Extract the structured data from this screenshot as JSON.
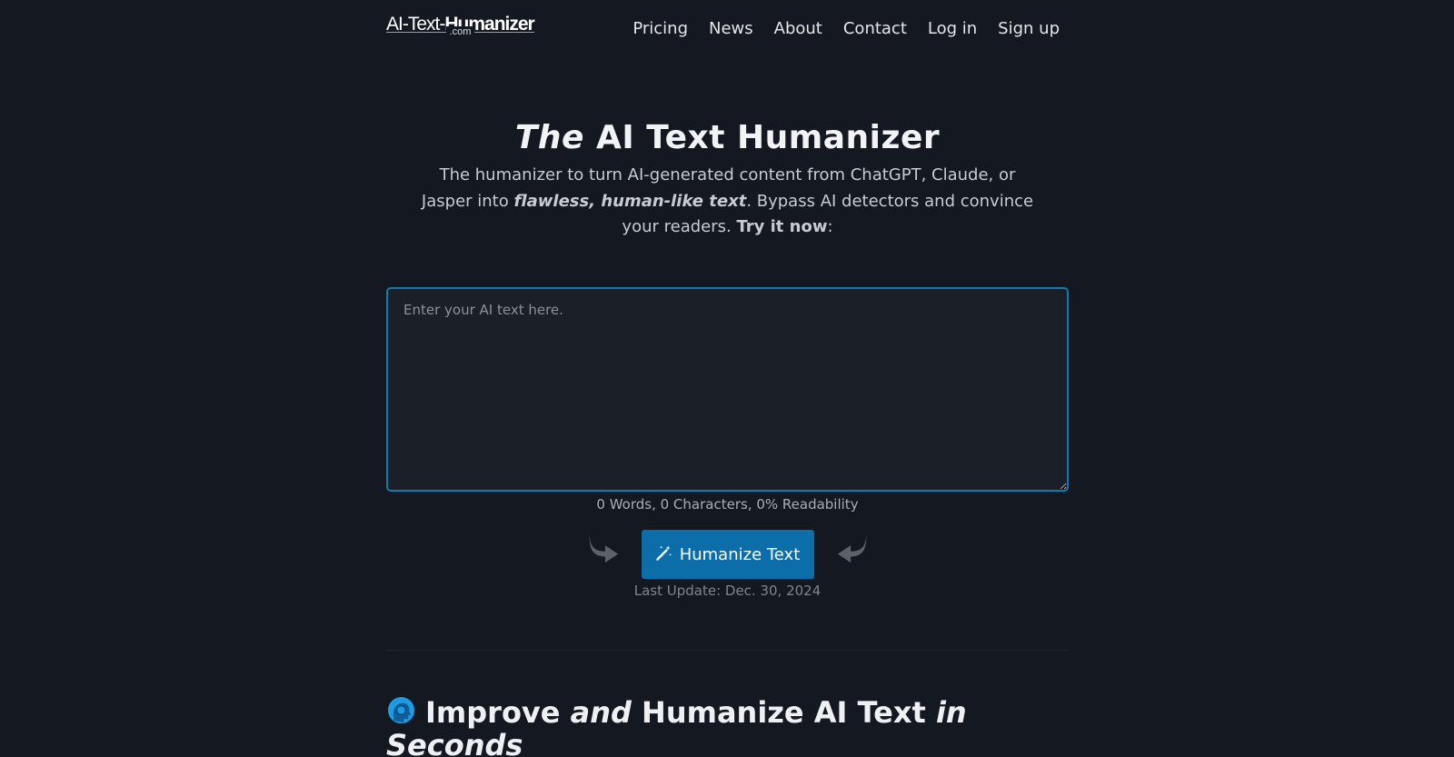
{
  "header": {
    "logo_part1": "AI-Text-",
    "logo_part2": "Humanizer",
    "logo_sub": ".com",
    "nav": [
      "Pricing",
      "News",
      "About",
      "Contact",
      "Log in",
      "Sign up"
    ]
  },
  "hero": {
    "title_em": "The",
    "title_rest": " AI Text Humanizer",
    "desc_1": "The humanizer to turn AI-generated content from ChatGPT, Claude, or Jasper into ",
    "desc_em": "flawless, human-like text",
    "desc_2": ". Bypass AI detectors and convince your readers. ",
    "desc_strong": "Try it now",
    "desc_3": ":"
  },
  "editor": {
    "placeholder": "Enter your AI text here.",
    "value": "",
    "stats": "0 Words, 0 Characters, 0% Readability"
  },
  "actions": {
    "button_label": "Humanize Text",
    "button_icon": "magic-wand-icon",
    "left_arrow_icon": "curved-arrow-right-icon",
    "right_arrow_icon": "curved-arrow-left-icon",
    "last_update": "Last Update: Dec. 30, 2024"
  },
  "section": {
    "emoji": "head-profile-icon",
    "t1": "Improve ",
    "t2": "and",
    "t3": " Humanize AI Text ",
    "t4": "in Seconds"
  },
  "colors": {
    "background": "#141821",
    "accent": "#0b6ea8",
    "textarea_border": "#1379b0"
  }
}
